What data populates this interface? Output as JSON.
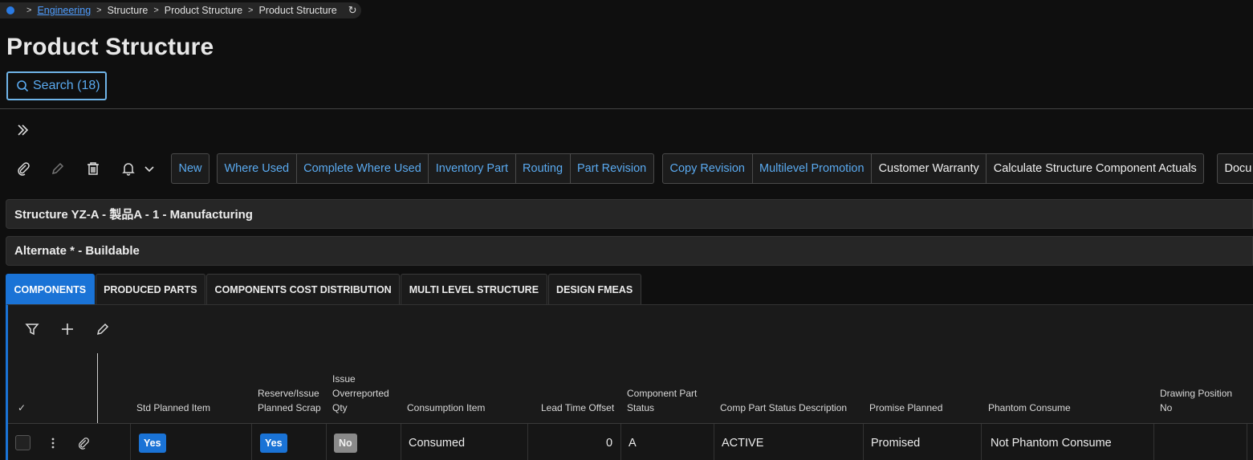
{
  "breadcrumb": {
    "items": [
      "Engineering",
      "Structure",
      "Product Structure",
      "Product Structure"
    ]
  },
  "page": {
    "title": "Product Structure"
  },
  "search": {
    "label": "Search (18)"
  },
  "toolbar": {
    "group1": [
      "New"
    ],
    "group2": [
      "Where Used",
      "Complete Where Used",
      "Inventory Part",
      "Routing",
      "Part Revision"
    ],
    "group3": [
      "Copy Revision",
      "Multilevel Promotion",
      "Customer Warranty",
      "Calculate Structure Component Actuals"
    ],
    "group4": [
      "Docu"
    ]
  },
  "panels": {
    "structure": "Structure YZ-A - 製品A - 1 - Manufacturing",
    "alternate": "Alternate * - Buildable"
  },
  "tabs": [
    "COMPONENTS",
    "PRODUCED PARTS",
    "COMPONENTS COST DISTRIBUTION",
    "MULTI LEVEL STRUCTURE",
    "DESIGN FMEAS"
  ],
  "grid": {
    "check_header": "✓",
    "columns": {
      "std_planned_item": "Std Planned Item",
      "reserve_issue_1": "Reserve/Issue",
      "reserve_issue_2": "Planned Scrap",
      "issue_over_1": "Issue",
      "issue_over_2": "Overreported",
      "issue_over_3": "Qty",
      "consumption_item": "Consumption Item",
      "lead_time_offset": "Lead Time Offset",
      "component_part_status_1": "Component Part",
      "component_part_status_2": "Status",
      "comp_part_status_desc": "Comp Part Status Description",
      "promise_planned": "Promise Planned",
      "phantom_consume": "Phantom Consume",
      "drawing_position_1": "Drawing Position",
      "drawing_position_2": "No"
    },
    "rows": [
      {
        "std_planned_item": "Yes",
        "reserve_issue": "Yes",
        "issue_overreported": "No",
        "consumption_item": "Consumed",
        "lead_time_offset": "0",
        "component_part_status": "A",
        "comp_part_status_desc": "ACTIVE",
        "promise_planned": "Promised",
        "phantom_consume": "Not Phantom Consume"
      }
    ]
  },
  "colors": {
    "accent": "#1a73d6",
    "link": "#5aaaf0",
    "background": "#0f0f0f"
  }
}
